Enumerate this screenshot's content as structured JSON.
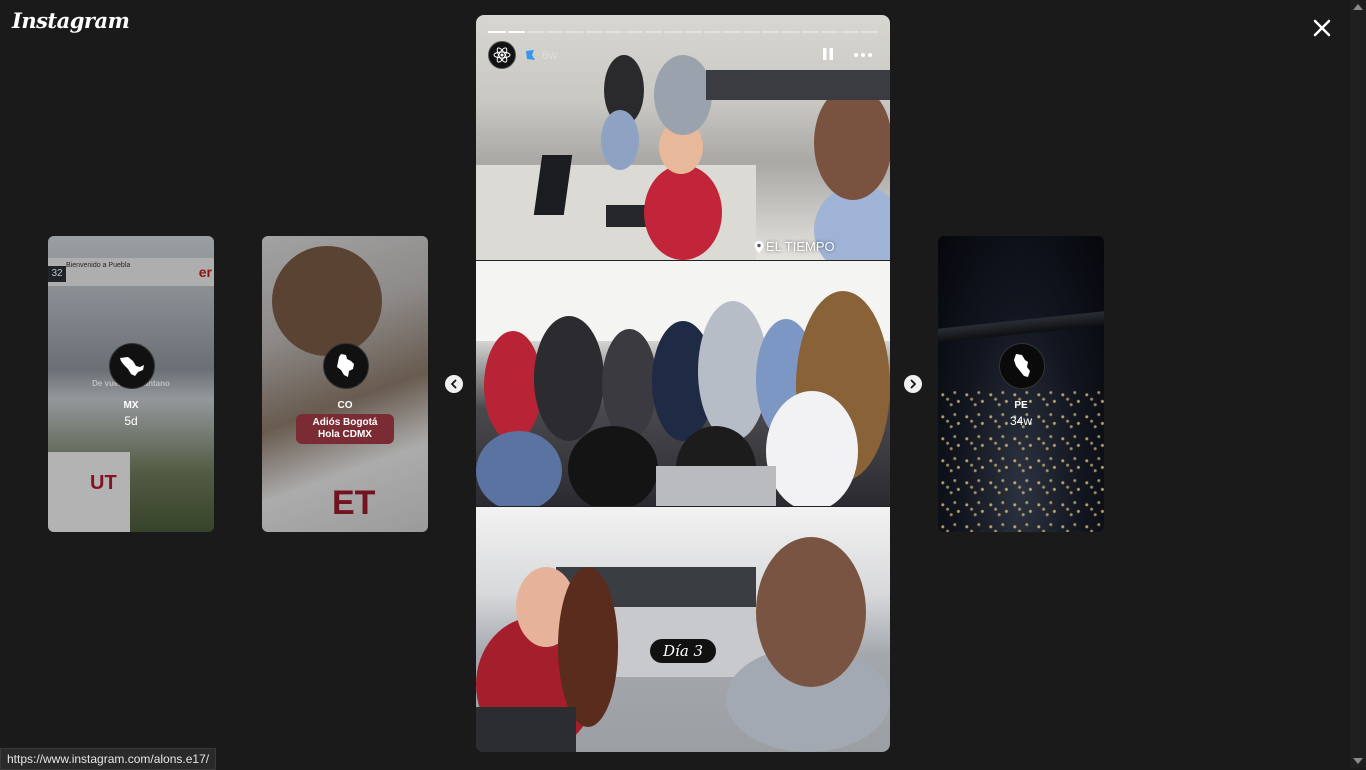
{
  "app": {
    "logo": "Instagram"
  },
  "previews": [
    {
      "id": "mx",
      "username": "MX",
      "age": "5d",
      "caption": "De vuelta al pantano",
      "banner": "Bienvenido a Puebla",
      "number": "32"
    },
    {
      "id": "co",
      "username": "CO",
      "age": "6d",
      "tag_line_1": "Adiós Bogotá",
      "tag_line_2": "Hola CDMX"
    },
    {
      "id": "pe",
      "username": "PE",
      "age": "34w"
    }
  ],
  "story": {
    "age": "6w",
    "progress": {
      "segments": 20,
      "current": 2
    },
    "location_sticker": "EL TIEMPO",
    "day_sticker": "Día 3"
  },
  "status_bar": {
    "url": "https://www.instagram.com/alons.e17/"
  },
  "colors": {
    "background": "#1a1a1a",
    "accent_tag": "#7a2b34",
    "verified": "#3797f0"
  },
  "icons": [
    "close-icon",
    "chevron-left-icon",
    "chevron-right-icon",
    "pause-icon",
    "more-icon",
    "atom-icon",
    "verified-icon",
    "location-pin-icon",
    "mexico-map-icon",
    "colombia-map-icon",
    "peru-map-icon"
  ]
}
